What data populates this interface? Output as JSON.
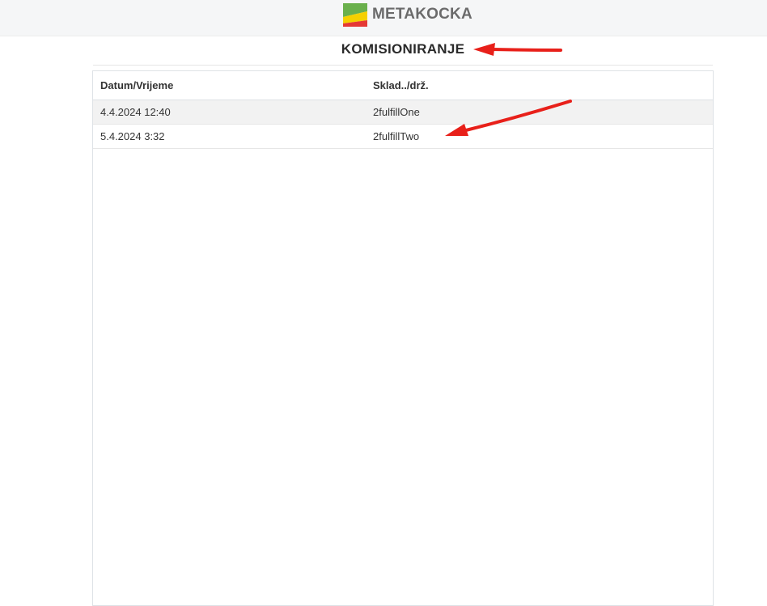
{
  "header": {
    "logo_text": "METAKOCKA",
    "logo_colors": [
      "#6ab04c",
      "#f5d000",
      "#e53935"
    ]
  },
  "page": {
    "title": "KOMISIONIRANJE"
  },
  "table": {
    "columns": [
      "Datum/Vrijeme",
      "Sklad../drž."
    ],
    "rows": [
      [
        "4.4.2024 12:40",
        "2fulfillOne"
      ],
      [
        "5.4.2024 3:32",
        "2fulfillTwo"
      ]
    ]
  },
  "annotations": {
    "arrow_color": "#e8201a",
    "arrows": [
      "arrow-to-title",
      "arrow-to-row-2"
    ]
  }
}
